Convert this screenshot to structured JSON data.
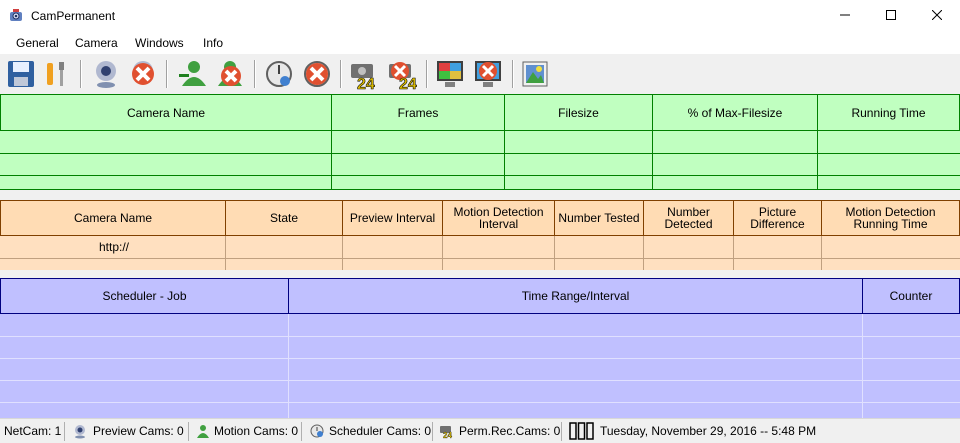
{
  "window": {
    "title": "CamPermanent"
  },
  "menu": [
    "General",
    "Camera",
    "Windows",
    "Info"
  ],
  "toolbar": {
    "buttons": [
      "save-icon",
      "settings-tools-icon",
      "webcam-icon",
      "webcam-delete-icon",
      "user-add-icon",
      "user-delete-icon",
      "motion-detection-icon",
      "motion-detection-delete-icon",
      "camera-24-icon",
      "camera-24-delete-icon",
      "monitor-icon",
      "monitor-delete-icon",
      "picture-icon"
    ]
  },
  "grid1": {
    "columns": [
      "Camera Name",
      "Frames",
      "Filesize",
      "% of Max-Filesize",
      "Running Time"
    ]
  },
  "grid2": {
    "columns": [
      "Camera Name",
      "State",
      "Preview Interval",
      "Motion Detection Interval",
      "Number Tested",
      "Number Detected",
      "Picture Difference",
      "Motion Detection Running Time"
    ],
    "rows": [
      [
        "http://",
        "",
        "",
        "",
        "",
        "",
        "",
        ""
      ]
    ]
  },
  "grid3": {
    "columns": [
      "Scheduler - Job",
      "Time Range/Interval",
      "Counter"
    ]
  },
  "status": {
    "netcam": "NetCam: 1",
    "preview": "Preview Cams: 0",
    "motion": "Motion Cams: 0",
    "scheduler": "Scheduler Cams: 0",
    "permrec": "Perm.Rec.Cams: 0",
    "datetime": "Tuesday, November 29, 2016 -- 5:48 PM"
  },
  "colors": {
    "grid1": "#c0ffc0",
    "grid2": "#ffe0c0",
    "grid3": "#c0c0ff"
  }
}
